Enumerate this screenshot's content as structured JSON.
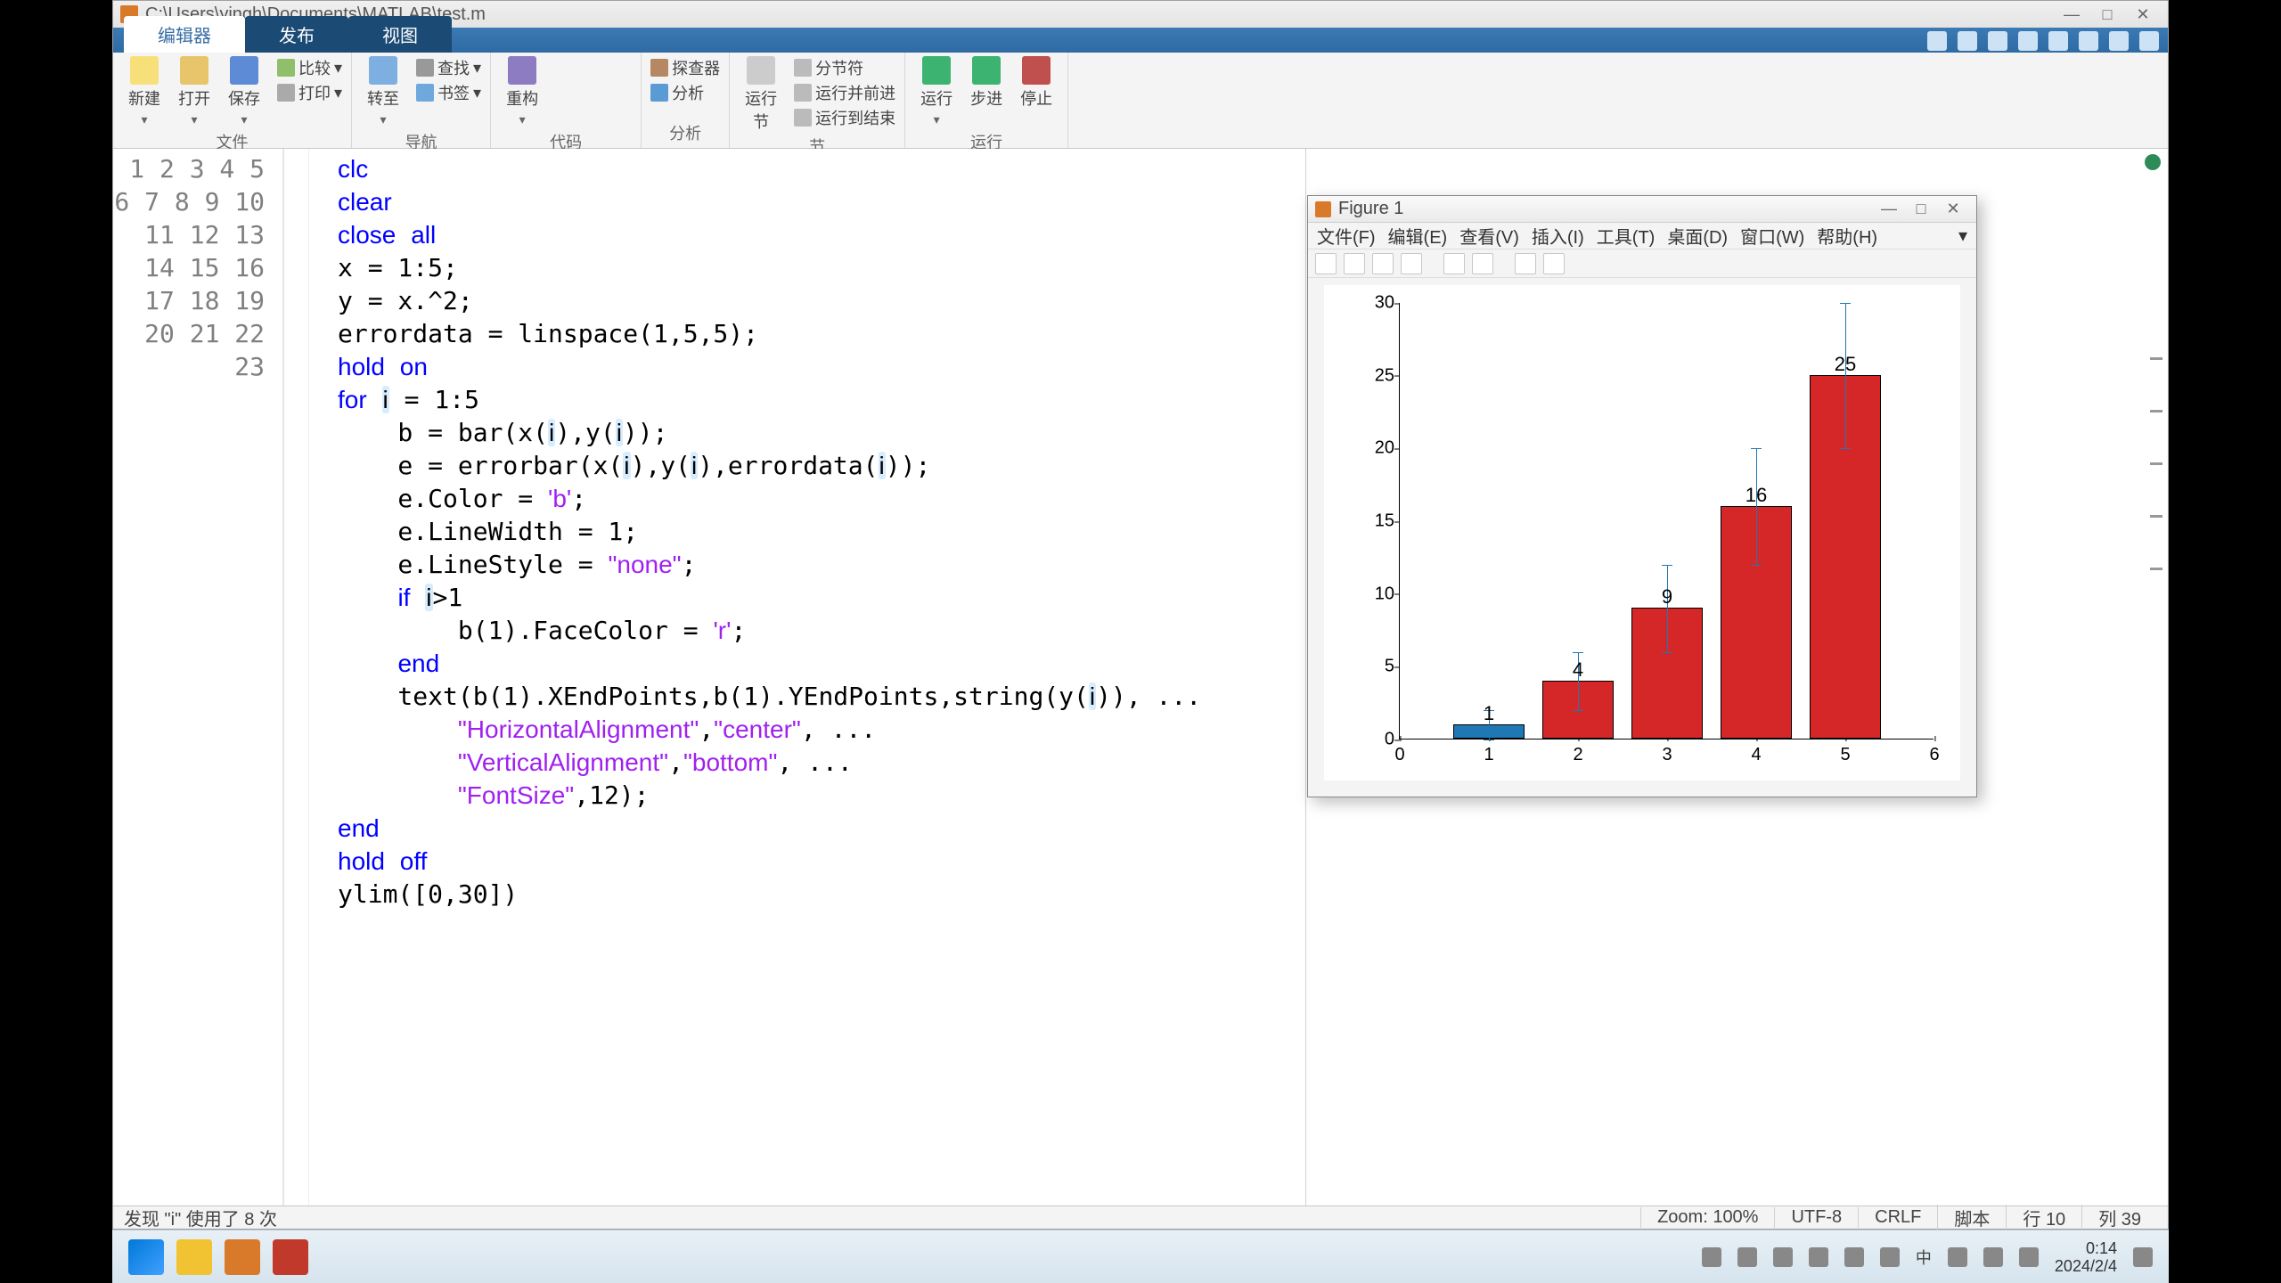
{
  "window": {
    "title": "C:\\Users\\yingh\\Documents\\MATLAB\\test.m"
  },
  "tabs": {
    "editor": "编辑器",
    "publish": "发布",
    "view": "视图"
  },
  "ribbon": {
    "file": {
      "new": "新建",
      "open": "打开",
      "save": "保存",
      "compare": "比较",
      "print": "打印",
      "label": "文件"
    },
    "nav": {
      "goto": "转至",
      "find": "查找",
      "bookmark": "书签",
      "label": "导航"
    },
    "code": {
      "refactor": "重构",
      "label": "代码"
    },
    "analyze": {
      "analyze": "分析",
      "label": "分析"
    },
    "section": {
      "runsec": "运行\n节",
      "split": "分节符",
      "runadv": "运行并前进",
      "runend": "运行到结束",
      "label": "节"
    },
    "run": {
      "run": "运行",
      "step": "步进",
      "stop": "停止",
      "label": "运行"
    },
    "profiler": "探查器"
  },
  "code_lines": [
    "clc",
    "clear",
    "close all",
    "x = 1:5;",
    "y = x.^2;",
    "errordata = linspace(1,5,5);",
    "hold on",
    "for i = 1:5",
    "    b = bar(x(i),y(i));",
    "    e = errorbar(x(i),y(i),errordata(i));",
    "    e.Color = 'b';",
    "    e.LineWidth = 1;",
    "    e.LineStyle = \"none\";",
    "    if i>1",
    "        b(1).FaceColor = 'r';",
    "    end",
    "    text(b(1).XEndPoints,b(1).YEndPoints,string(y(i)), ...",
    "        \"HorizontalAlignment\",\"center\", ...",
    "        \"VerticalAlignment\",\"bottom\", ...",
    "        \"FontSize\",12);",
    "end",
    "hold off",
    "ylim([0,30])"
  ],
  "status": {
    "left": "发现 \"i\" 使用了 8 次",
    "zoom": "Zoom: 100%",
    "enc": "UTF-8",
    "eol": "CRLF",
    "type": "脚本",
    "line_lbl": "行",
    "line": "10",
    "col_lbl": "列",
    "col": "39"
  },
  "figure": {
    "title": "Figure 1",
    "menus": [
      "文件(F)",
      "编辑(E)",
      "查看(V)",
      "插入(I)",
      "工具(T)",
      "桌面(D)",
      "窗口(W)",
      "帮助(H)"
    ]
  },
  "chart_data": {
    "type": "bar",
    "categories": [
      1,
      2,
      3,
      4,
      5
    ],
    "values": [
      1,
      4,
      9,
      16,
      25
    ],
    "errors": [
      1,
      2,
      3,
      4,
      5
    ],
    "colors": [
      "#1f77b4",
      "#d62728",
      "#d62728",
      "#d62728",
      "#d62728"
    ],
    "data_labels": [
      "1",
      "4",
      "9",
      "16",
      "25"
    ],
    "xticks": [
      0,
      1,
      2,
      3,
      4,
      5,
      6
    ],
    "yticks": [
      0,
      5,
      10,
      15,
      20,
      25,
      30
    ],
    "ylim": [
      0,
      30
    ],
    "xlim": [
      0,
      6
    ]
  },
  "tray": {
    "ime": "中",
    "time": "0:14",
    "date": "2024/2/4"
  }
}
